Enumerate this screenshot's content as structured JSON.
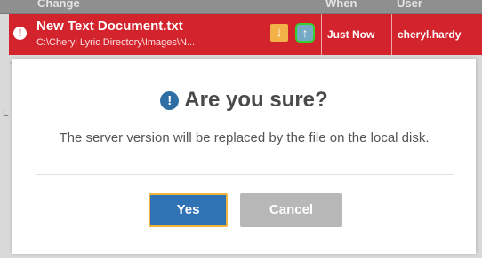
{
  "table": {
    "columns": {
      "change": "Change",
      "when": "When",
      "user": "User"
    },
    "row": {
      "status_icon": "exclamation-icon",
      "file_name": "New Text Document.txt",
      "path": "C:\\Cheryl Lyric Directory\\Images\\N...",
      "when": "Just Now",
      "user": "cheryl.hardy",
      "actions": {
        "download_icon": "arrow-down-icon",
        "upload_icon": "arrow-up-icon"
      }
    },
    "partial_row_text": "· ·   ·  ·· ·    ·  ·  ·· ·  ·",
    "left_edge_char": "L"
  },
  "dialog": {
    "title_icon": "exclamation-circle-icon",
    "title": "Are you sure?",
    "message": "The server version will be replaced by the file on the local disk.",
    "buttons": {
      "confirm": "Yes",
      "cancel": "Cancel"
    }
  },
  "colors": {
    "row_error": "#d3232c",
    "download_button": "#f2b248",
    "upload_button": "#76aac4",
    "upload_highlight": "#35d12f",
    "primary": "#2f73b5",
    "primary_focus": "#f0b441",
    "cancel": "#b7b7b7"
  }
}
